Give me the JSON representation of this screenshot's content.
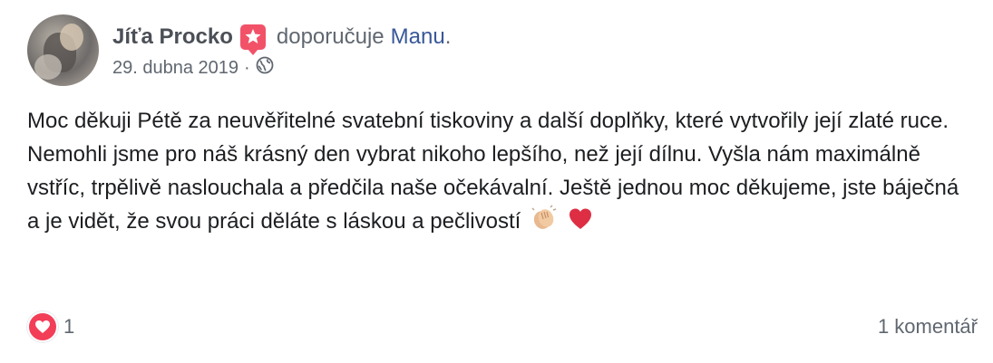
{
  "post": {
    "author": "Jíťa Procko",
    "action": "doporučuje",
    "page": "Manu",
    "page_suffix": ".",
    "date": "29. dubna 2019",
    "date_separator": "·",
    "privacy_icon": "globe-icon",
    "badge_icon": "star-icon",
    "text": "Moc děkuji Pétě za neuvěřitelné svatební tiskoviny a další doplňky, které vytvořily její zlaté ruce. Nemohli jsme pro náš krásný den vybrat nikoho lepšího, než její dílnu. Vyšla nám maximálně vstříc, trpělivě naslouchala a předčila naše očekávalní. Ještě jednou moc děkujeme, jste báječná a je vidět, že svou práci děláte s láskou a pečlivostí",
    "emojis": [
      "clapping-hands-emoji",
      "red-heart-emoji"
    ]
  },
  "footer": {
    "reaction_icon": "love-reaction-icon",
    "reaction_count": "1",
    "comments": "1 komentář"
  },
  "colors": {
    "badge": "#f25268",
    "link": "#385898",
    "love": "#f33e58",
    "secondary_text": "#606770"
  }
}
